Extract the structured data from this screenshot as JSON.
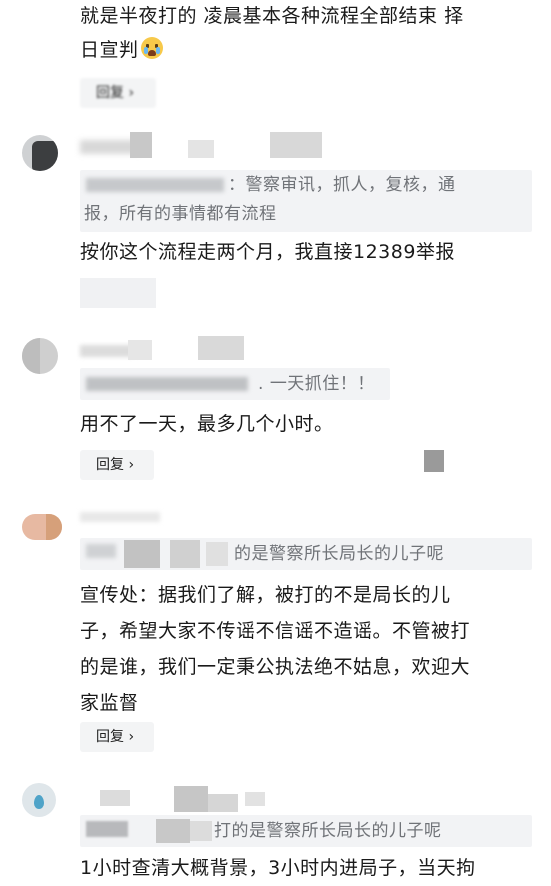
{
  "comments": [
    {
      "text_line1": "就是半夜打的 凌晨基本各种流程全部结束 择",
      "text_line2": "日宣判",
      "emoji": "crying-face",
      "reply_label": "回复"
    },
    {
      "quote_suffix": "警察审讯，抓人，复核，通",
      "quote_line2": "报，所有的事情都有流程",
      "text": "按你这个流程走两个月，我直接12389举报"
    },
    {
      "quote_suffix": "一天抓住！！",
      "text": "用不了一天，最多几个小时。",
      "reply_label": "回复"
    },
    {
      "quote_suffix": "的是警察所长局长的儿子呢",
      "text_lines": [
        "宣传处：据我们了解，被打的不是局长的儿",
        "子，希望大家不传谣不信谣不造谣。不管被打",
        "的是谁，我们一定秉公执法绝不姑息，欢迎大",
        "家监督"
      ],
      "reply_label": "回复"
    },
    {
      "quote_suffix": "打的是警察所长局长的儿子呢",
      "text": "1小时查清大概背景，3小时内进局子，当天拘"
    }
  ],
  "colors": {
    "quote_bg": "#f2f3f5",
    "quote_text": "#707378",
    "body_text": "#1a1a1a",
    "reply_bg": "#f3f4f5"
  }
}
